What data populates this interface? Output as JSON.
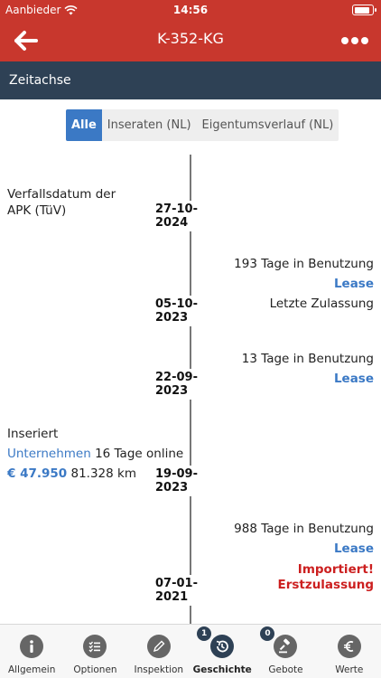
{
  "status": {
    "carrier": "Aanbieder",
    "time": "14:56"
  },
  "nav": {
    "title": "K-352-KG",
    "back_icon": "arrow-left-icon",
    "more_icon": "more-dots-icon"
  },
  "section": {
    "title": "Zeitachse"
  },
  "filters": [
    {
      "label": "Alle",
      "active": true
    },
    {
      "label": "Inseraten (NL)",
      "active": false
    },
    {
      "label": "Eigentumsverlauf (NL)",
      "active": false
    }
  ],
  "events": {
    "apk": {
      "line1": "Verfallsdatum der",
      "line2": "APK (TüV)",
      "date": "27-10-2024"
    },
    "e2": {
      "days": "193 Tage in Benutzung",
      "type": "Lease",
      "note": "Letzte Zulassung",
      "date": "05-10-2023"
    },
    "e3": {
      "days": "13 Tage in Benutzung",
      "type": "Lease",
      "date": "22-09-2023"
    },
    "e4": {
      "title": "Inseriert",
      "seller": "Unternehmen",
      "online": "16 Tage online",
      "price": "€ 47.950",
      "km": "81.328 km",
      "date": "19-09-2023"
    },
    "e5": {
      "days": "988 Tage in Benutzung",
      "type": "Lease",
      "alert1": "Importiert!",
      "alert2": "Erstzulassung",
      "date": "07-01-2021"
    }
  },
  "tabs": [
    {
      "label": "Allgemein",
      "icon": "info-icon"
    },
    {
      "label": "Optionen",
      "icon": "checklist-icon"
    },
    {
      "label": "Inspektion",
      "icon": "pencil-icon"
    },
    {
      "label": "Geschichte",
      "icon": "history-icon",
      "badge": "1",
      "active": true
    },
    {
      "label": "Gebote",
      "icon": "gavel-icon",
      "badge": "0"
    },
    {
      "label": "Werte",
      "icon": "euro-icon"
    }
  ]
}
